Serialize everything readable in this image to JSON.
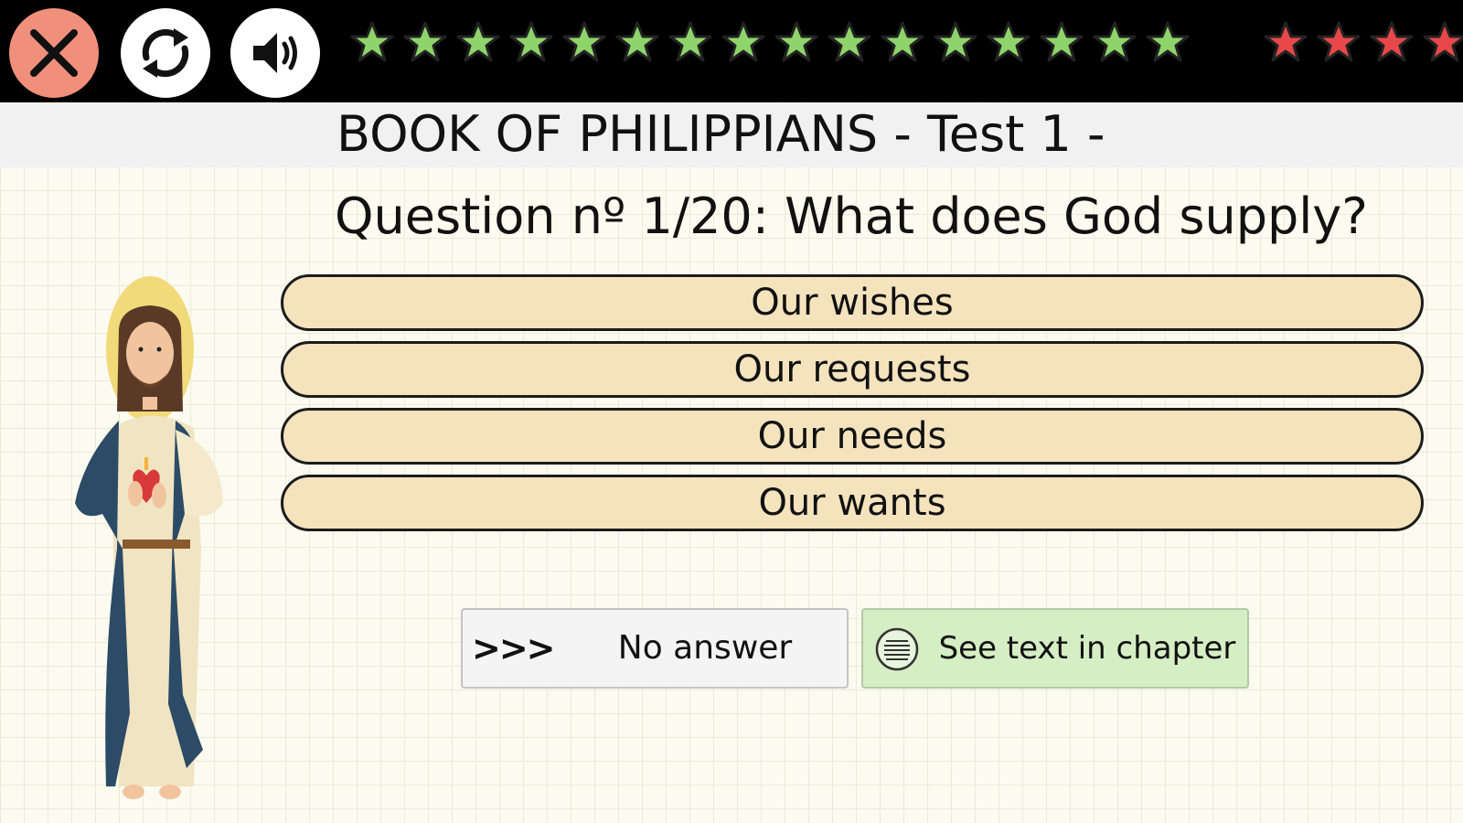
{
  "toolbar": {
    "close_icon": "close-icon",
    "refresh_icon": "refresh-icon",
    "sound_icon": "speaker-icon"
  },
  "progress": {
    "green_star_color": "#8fd46a",
    "red_star_color": "#e8484a",
    "green_stars_shown": 16,
    "red_stars_shown": 4
  },
  "title": "BOOK OF PHILIPPIANS - Test 1 -",
  "question": "Question nº 1/20: What does God supply?",
  "answers": [
    {
      "label": "Our wishes"
    },
    {
      "label": "Our requests"
    },
    {
      "label": "Our needs"
    },
    {
      "label": "Our wants"
    }
  ],
  "actions": {
    "no_answer_arrows": ">>>",
    "no_answer_label": "No answer",
    "see_text_label": "See text in chapter"
  },
  "colors": {
    "answer_fill": "#f4e3bd",
    "close_button": "#f0907a",
    "see_text_fill": "#d5eec4"
  }
}
